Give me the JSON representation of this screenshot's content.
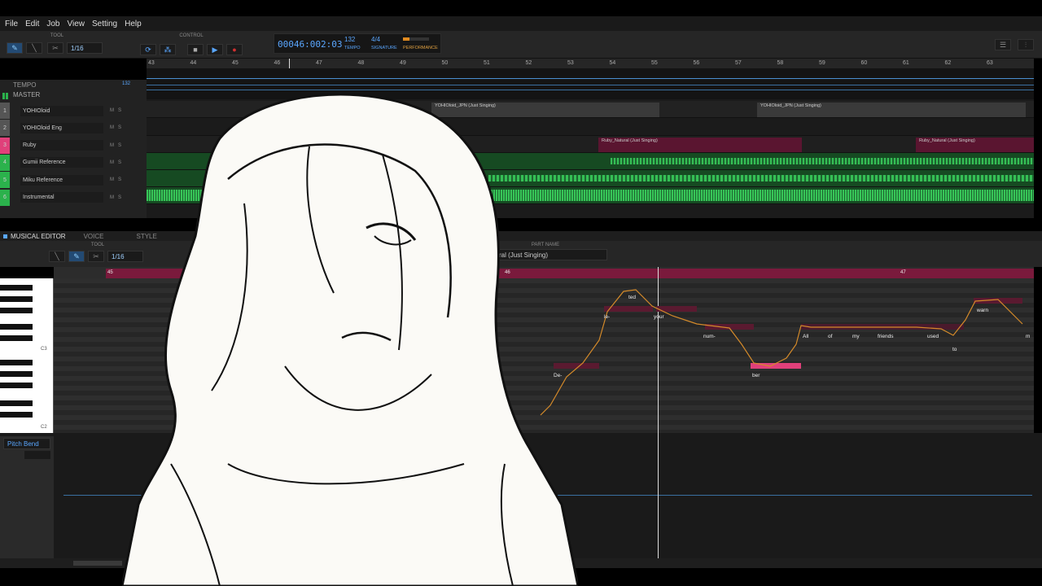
{
  "menu": [
    "File",
    "Edit",
    "Job",
    "View",
    "Setting",
    "Help"
  ],
  "toolbar": {
    "tool_label": "TOOL",
    "control_label": "CONTROL",
    "quantize": "1/16"
  },
  "transport": {
    "time": "00046:002:03",
    "tempo_value": "132",
    "tempo_label": "TEMPO",
    "signature_value": "4/4",
    "signature_label": "SIGNATURE",
    "performance_label": "PERFORMANCE"
  },
  "ruler_ticks": [
    "43",
    "44",
    "45",
    "46",
    "47",
    "48",
    "49",
    "50",
    "51",
    "52",
    "53",
    "54",
    "55",
    "56",
    "57",
    "58",
    "59",
    "60",
    "61",
    "62",
    "63"
  ],
  "tempo_lane": {
    "label": "TEMPO",
    "value": "132"
  },
  "master_label": "MASTER",
  "tracks": [
    {
      "num": "1",
      "name": "YOHIOloid",
      "color": "#555555"
    },
    {
      "num": "2",
      "name": "YOHIOloid Eng",
      "color": "#555555"
    },
    {
      "num": "3",
      "name": "Ruby",
      "color": "#e0407a"
    },
    {
      "num": "4",
      "name": "Gumii Reference",
      "color": "#2bb24c"
    },
    {
      "num": "5",
      "name": "Miku Reference",
      "color": "#2bb24c"
    },
    {
      "num": "6",
      "name": "Instrumental",
      "color": "#2bb24c"
    }
  ],
  "clips": {
    "yohio_1": "YOHIOloid_JPN (Just Singing)",
    "yohio_2": "YOHIOloid_JPN (Just Singing)",
    "ruby_1": "Ruby_Natural (Just Singing)",
    "ruby_2": "Ruby_Natural (Just Singing)"
  },
  "editor": {
    "tab_musical": "MUSICAL EDITOR",
    "tab_voice": "VOICE",
    "tab_style": "STYLE",
    "tool_label": "TOOL",
    "quantize": "1/16",
    "part_name_label": "PART NAME",
    "part_name_value": "ral (Just Singing)",
    "bar_45": "45",
    "bar_46": "46",
    "bar_47": "47",
    "c3_label": "C3",
    "c2_label": "C2"
  },
  "lyrics": [
    "De-",
    "le-",
    "ted",
    "your",
    "num-",
    "ber",
    "All",
    "of",
    "my",
    "friends",
    "used",
    "to",
    "warn",
    "m"
  ],
  "param": {
    "selector": "Pitch Bend"
  },
  "colors": {
    "accent": "#5aa7ff",
    "audio": "#2bb24c",
    "vocal_part": "#e0407a",
    "pitch_curve": "#d48a2a"
  }
}
